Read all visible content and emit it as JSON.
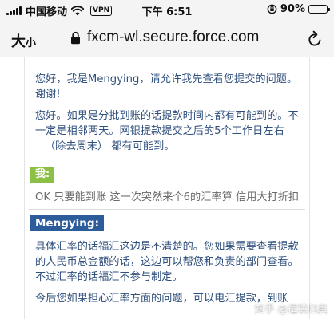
{
  "status_bar": {
    "carrier": "中国移动",
    "vpn": "VPN",
    "time": "下午 6:51",
    "battery_percent": "90%",
    "battery_level": 0.9
  },
  "address_bar": {
    "text_size_big": "大",
    "text_size_small": "小",
    "url": "fxcm-wl.secure.force.com"
  },
  "chat": {
    "agent_intro_lines": [
      "您好，我是Mengying，请允许我先查看您提交的问题。",
      "谢谢!"
    ],
    "agent_reply1_lines": [
      "您好。如果是分批到账的话提款时间内都有可能到的。不",
      "一定是相邻两天。网银提款提交之后的5个工作日左右",
      "（除去周末） 都有可能到。"
    ],
    "user_tag": "我:",
    "user_message": "OK 只要能到账 这一次突然来个6的汇率算 信用大打折扣",
    "agent_tag": "Mengying:",
    "agent_reply2_lines": [
      "具体汇率的话福汇这边是不清楚的。您如果需要查看提款",
      "的人民币总金额的话，这边可以帮您和负责的部门查看。",
      "不过汇率的话福汇不参与制定。"
    ],
    "agent_reply3_line": "今后您如果担心汇率方面的问题，可以电汇提款，到账",
    "watermark": "知乎 @逗璞归真"
  }
}
